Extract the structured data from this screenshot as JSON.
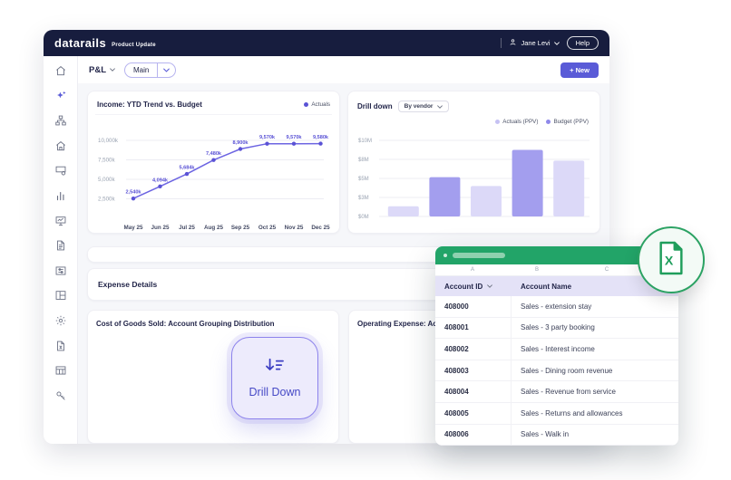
{
  "topbar": {
    "logo": "datarails",
    "subtitle": "Product Update",
    "user_name": "Jane Levi",
    "help_label": "Help"
  },
  "toolbar": {
    "page_title": "P&L",
    "view_selector": "Main",
    "new_button_label": "+ New"
  },
  "sidebar_icons": [
    "home",
    "ai-sparkles",
    "hierarchy",
    "home-alt",
    "card-gear",
    "bar-chart",
    "monitor-chart",
    "document",
    "card-settings",
    "layout-columns",
    "settings-gear",
    "file-x",
    "table",
    "key"
  ],
  "chart_data": [
    {
      "type": "line",
      "title": "Income: YTD Trend vs. Budget",
      "legend": [
        "Actuals"
      ],
      "x": [
        "May 25",
        "Jun 25",
        "Jul 25",
        "Aug 25",
        "Sep 25",
        "Oct 25",
        "Nov 25",
        "Dec 25"
      ],
      "values": [
        2540,
        4094,
        5684,
        7480,
        8900,
        9570,
        9570,
        9580
      ],
      "point_labels": [
        "2,540k",
        "4,094k",
        "5,684k",
        "7,480k",
        "8,900k",
        "9,570k",
        "9,570k",
        "9,580k"
      ],
      "y_ticks": [
        "10,000k",
        "7,500k",
        "5,000k",
        "2,500k"
      ],
      "y_tick_values": [
        10000,
        7500,
        5000,
        2500
      ],
      "ylim": [
        0,
        10000
      ],
      "grid": true,
      "legend_position": "top-right"
    },
    {
      "type": "bar",
      "title": "Drill down",
      "filter_label": "By vendor",
      "legend": [
        "Actuals (PPV)",
        "Budget (PPV)"
      ],
      "series_membership": [
        "Actuals (PPV)",
        "Budget (PPV)",
        "Actuals (PPV)",
        "Budget (PPV)",
        "Actuals (PPV)"
      ],
      "values": [
        1.6,
        5.2,
        4.2,
        9.0,
        7.8
      ],
      "y_ticks": [
        "$10M",
        "$8M",
        "$5M",
        "$3M",
        "$0M"
      ],
      "y_tick_values": [
        10,
        8,
        5,
        3,
        0
      ],
      "ylim": [
        0,
        10
      ],
      "grid": true,
      "legend_position": "top-right"
    }
  ],
  "expense_section": {
    "title": "Expense Details"
  },
  "bottom_cards": [
    {
      "title": "Cost of Goods Sold: Account Grouping Distribution"
    },
    {
      "title": "Operating Expense: Accou"
    }
  ],
  "drill_down_button": {
    "label": "Drill Down"
  },
  "spreadsheet": {
    "column_letters": [
      "A",
      "B",
      "C"
    ],
    "headers": [
      "Account ID",
      "Account Name"
    ],
    "rows": [
      [
        "408000",
        "Sales - extension stay"
      ],
      [
        "408001",
        "Sales - 3 party booking"
      ],
      [
        "408002",
        "Sales - Interest income"
      ],
      [
        "408003",
        "Sales - Dining room revenue"
      ],
      [
        "408004",
        "Sales - Revenue from service"
      ],
      [
        "408005",
        "Sales - Returns and allowances"
      ],
      [
        "408006",
        "Sales - Walk in"
      ]
    ]
  },
  "colors": {
    "accent_purple": "#5a5bd7",
    "line_color": "#6c64e2",
    "point_label_color": "#5a52d5",
    "bar_light": "#dcd9f8",
    "bar_dark": "#a39eee",
    "legend_dot_actuals_ppv": "#c6c2f3",
    "legend_dot_budget_ppv": "#8f89ea",
    "topbar_navy": "#171d3e",
    "excel_green": "#22a468"
  }
}
